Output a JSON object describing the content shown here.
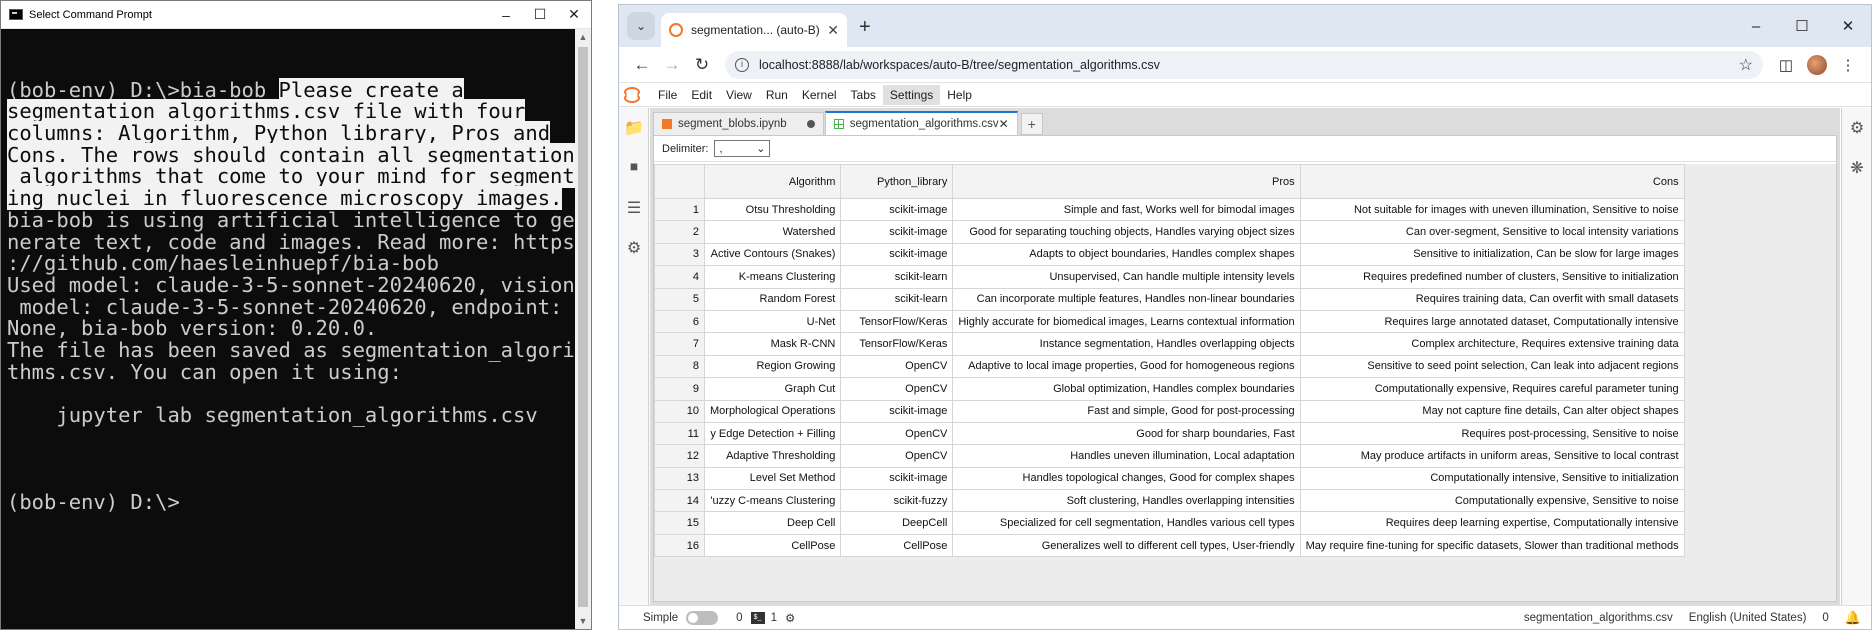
{
  "cmd": {
    "title": "Select Command Prompt",
    "lines": [
      {
        "text": "",
        "hl": ""
      },
      {
        "text": "(bob-env) D:\\>bia-bob ",
        "hl": "Please create a"
      },
      {
        "text": "",
        "hl": "segmentation_algorithms.csv file with four"
      },
      {
        "text": "",
        "hl": "columns: Algorithm, Python_library, Pros and"
      },
      {
        "text": "",
        "hl": "Cons. The rows should contain all segmentation"
      },
      {
        "text": "",
        "hl": " algorithms that come to your mind for segment"
      },
      {
        "text": "",
        "hl": "ing nuclei in fluorescence microscopy images."
      },
      {
        "text": "bia-bob is using artificial intelligence to ge",
        "hl": ""
      },
      {
        "text": "nerate text, code and images. Read more: https",
        "hl": ""
      },
      {
        "text": "://github.com/haesleinhuepf/bia-bob",
        "hl": ""
      },
      {
        "text": "Used model: claude-3-5-sonnet-20240620, vision",
        "hl": ""
      },
      {
        "text": " model: claude-3-5-sonnet-20240620, endpoint:",
        "hl": ""
      },
      {
        "text": "None, bia-bob version: 0.20.0.",
        "hl": ""
      },
      {
        "text": "The file has been saved as segmentation_algori",
        "hl": ""
      },
      {
        "text": "thms.csv. You can open it using:",
        "hl": ""
      },
      {
        "text": "",
        "hl": ""
      },
      {
        "text": "    jupyter lab segmentation_algorithms.csv",
        "hl": ""
      },
      {
        "text": "",
        "hl": ""
      },
      {
        "text": "",
        "hl": ""
      },
      {
        "text": "",
        "hl": ""
      },
      {
        "text": "(bob-env) D:\\>",
        "hl": ""
      }
    ]
  },
  "browser": {
    "tab_title": "segmentation... (auto-B) - Jupyt",
    "url": "localhost:8888/lab/workspaces/auto-B/tree/segmentation_algorithms.csv"
  },
  "jupyter": {
    "menu": [
      "File",
      "Edit",
      "View",
      "Run",
      "Kernel",
      "Tabs",
      "Settings",
      "Help"
    ],
    "tabs": {
      "notebook": "segment_blobs.ipynb",
      "csv": "segmentation_algorithms.csv"
    },
    "delimiter_label": "Delimiter:",
    "delimiter_value": ",",
    "columns": [
      "Algorithm",
      "Python_library",
      "Pros",
      "Cons"
    ],
    "rows": [
      [
        "1",
        "Otsu Thresholding",
        "scikit-image",
        "Simple and fast, Works well for bimodal images",
        "Not suitable for images with uneven illumination, Sensitive to noise"
      ],
      [
        "2",
        "Watershed",
        "scikit-image",
        "Good for separating touching objects, Handles varying object sizes",
        "Can over-segment, Sensitive to local intensity variations"
      ],
      [
        "3",
        "Active Contours (Snakes)",
        "scikit-image",
        "Adapts to object boundaries, Handles complex shapes",
        "Sensitive to initialization, Can be slow for large images"
      ],
      [
        "4",
        "K-means Clustering",
        "scikit-learn",
        "Unsupervised, Can handle multiple intensity levels",
        "Requires predefined number of clusters, Sensitive to initialization"
      ],
      [
        "5",
        "Random Forest",
        "scikit-learn",
        "Can incorporate multiple features, Handles non-linear boundaries",
        "Requires training data, Can overfit with small datasets"
      ],
      [
        "6",
        "U-Net",
        "TensorFlow/Keras",
        "Highly accurate for biomedical images, Learns contextual information",
        "Requires large annotated dataset, Computationally intensive"
      ],
      [
        "7",
        "Mask R-CNN",
        "TensorFlow/Keras",
        "Instance segmentation, Handles overlapping objects",
        "Complex architecture, Requires extensive training data"
      ],
      [
        "8",
        "Region Growing",
        "OpenCV",
        "Adaptive to local image properties, Good for homogeneous regions",
        "Sensitive to seed point selection, Can leak into adjacent regions"
      ],
      [
        "9",
        "Graph Cut",
        "OpenCV",
        "Global optimization, Handles complex boundaries",
        "Computationally expensive, Requires careful parameter tuning"
      ],
      [
        "10",
        "Morphological Operations",
        "scikit-image",
        "Fast and simple, Good for post-processing",
        "May not capture fine details, Can alter object shapes"
      ],
      [
        "11",
        "y Edge Detection + Filling",
        "OpenCV",
        "Good for sharp boundaries, Fast",
        "Requires post-processing, Sensitive to noise"
      ],
      [
        "12",
        "Adaptive Thresholding",
        "OpenCV",
        "Handles uneven illumination, Local adaptation",
        "May produce artifacts in uniform areas, Sensitive to local contrast"
      ],
      [
        "13",
        "Level Set Method",
        "scikit-image",
        "Handles topological changes, Good for complex shapes",
        "Computationally intensive, Sensitive to initialization"
      ],
      [
        "14",
        "'uzzy C-means Clustering",
        "scikit-fuzzy",
        "Soft clustering, Handles overlapping intensities",
        "Computationally expensive, Sensitive to noise"
      ],
      [
        "15",
        "Deep Cell",
        "DeepCell",
        "Specialized for cell segmentation, Handles various cell types",
        "Requires deep learning expertise, Computationally intensive"
      ],
      [
        "16",
        "CellPose",
        "CellPose",
        "Generalizes well to different cell types, User-friendly",
        "May require fine-tuning for specific datasets, Slower than traditional methods"
      ]
    ],
    "status": {
      "mode": "Simple",
      "count_a": "0",
      "count_b": "1",
      "filename": "segmentation_algorithms.csv",
      "language": "English (United States)",
      "notifications": "0"
    }
  }
}
